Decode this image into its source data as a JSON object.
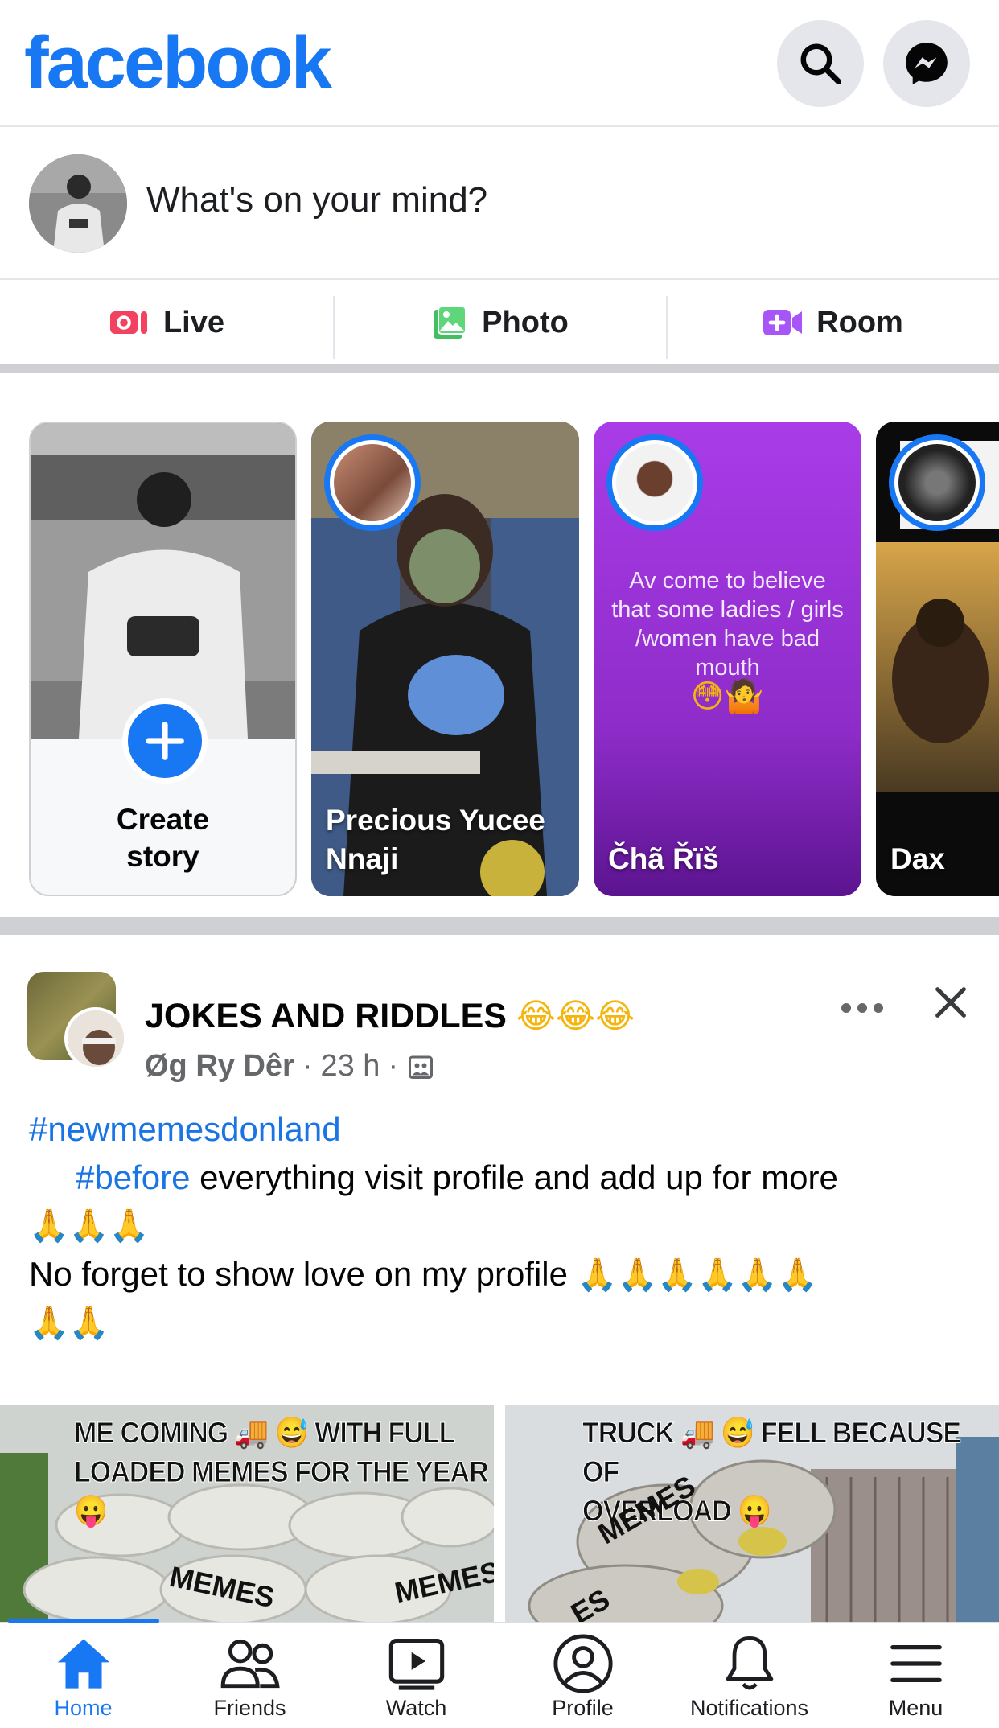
{
  "header": {
    "logo": "facebook",
    "search_icon": "search-icon",
    "messenger_icon": "messenger-icon"
  },
  "composer": {
    "placeholder": "What's on your mind?"
  },
  "actions": [
    {
      "label": "Live",
      "icon": "live-video-icon",
      "color": "#f3425f"
    },
    {
      "label": "Photo",
      "icon": "photo-icon",
      "color": "#45bd62"
    },
    {
      "label": "Room",
      "icon": "room-video-icon",
      "color": "#a855f7"
    }
  ],
  "stories": {
    "create": {
      "line1": "Create",
      "line2": "story"
    },
    "items": [
      {
        "name": "Precious Yucee Nnaji"
      },
      {
        "name": "Čhã Řïš",
        "text": "Av come to believe that some ladies / girls /women have bad mouth",
        "emoji": "😳🤷"
      },
      {
        "name": "Dax"
      }
    ]
  },
  "post": {
    "group": "JOKES AND RIDDLES",
    "group_emoji": "😂😂😂",
    "author": "Øg Ry Dêr",
    "time": "23 h",
    "hashtag1": "#newmemesdonland",
    "hashtag2": "#before",
    "line2_rest": " everything visit profile and add up for more",
    "line3_emoji": "🙏🙏🙏",
    "line4": "No forget to show love on my profile ",
    "line4_emoji": "🙏🙏🙏🙏🙏🙏",
    "line5_emoji": "🙏🙏",
    "meme1_caption_a": "ME COMING 🚚 😅 WITH FULL",
    "meme1_caption_b": "LOADED MEMES FOR THE YEAR 😛",
    "meme1_tag_a": "MEMES",
    "meme1_tag_b": "MEMES",
    "meme2_caption_a": "TRUCK 🚚 😅 FELL BECAUSE OF",
    "meme2_caption_b": "OVERLOAD 😛",
    "meme2_tag_a": "MEMES",
    "meme2_tag_b": "ES"
  },
  "tabbar": {
    "items": [
      {
        "label": "Home",
        "icon": "home-icon",
        "active": true
      },
      {
        "label": "Friends",
        "icon": "friends-icon"
      },
      {
        "label": "Watch",
        "icon": "watch-icon"
      },
      {
        "label": "Profile",
        "icon": "profile-icon"
      },
      {
        "label": "Notifications",
        "icon": "bell-icon"
      },
      {
        "label": "Menu",
        "icon": "menu-icon"
      }
    ]
  },
  "colors": {
    "brand": "#1877f2",
    "divider": "#ced0d4",
    "muted": "#65676b"
  }
}
